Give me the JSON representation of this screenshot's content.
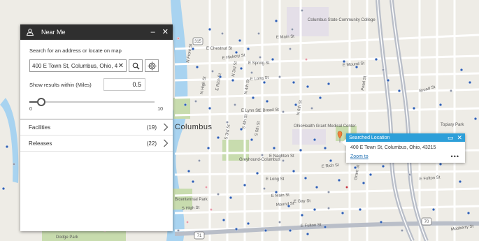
{
  "map": {
    "city_label": "Columbus",
    "street_labels": [
      "E Chestnut St",
      "E Hickory St",
      "E Spring St",
      "E Long St",
      "E Lynn St",
      "E Broad St",
      "E Rich St",
      "E Main St",
      "E Mound St",
      "E Fulton St",
      "Broad St",
      "E Naghten St",
      "E Long St",
      "E Main St",
      "Mound St",
      "Grant St",
      "E Rich St",
      "N 6th St",
      "N 4th St",
      "S 4th St",
      "S 5th St",
      "S 3rd St",
      "N Front St",
      "N High St",
      "S High St",
      "E Fulton St",
      "Mooberry St",
      "Pearl St",
      "N 3rd St",
      "E Gay St"
    ],
    "poi_labels": [
      "Columbus State Community College",
      "Greyhound-Columbus",
      "OhioHealth Grant Medical Center",
      "Dodge Park",
      "Bicentennial Park",
      "Topiary Park"
    ],
    "route_shields": [
      "315",
      "70",
      "71"
    ]
  },
  "panel": {
    "title": "Near Me",
    "minimize_symbol": "–",
    "close_symbol": "✕",
    "search_label": "Search for an address or locate on map",
    "search_value": "400 E Town St, Columbus, Ohio, 43215",
    "search_placeholder": "",
    "clear_symbol": "✕",
    "radius_label": "Show results within (Miles)",
    "radius_value": "0.5",
    "slider_min": "0",
    "slider_max": "10",
    "slider_fraction": 0.05,
    "results": [
      {
        "name": "Facilities",
        "count": "(19)"
      },
      {
        "name": "Releases",
        "count": "(22)"
      }
    ]
  },
  "popup": {
    "title": "Searched Location",
    "maximize_symbol": "▭",
    "close_symbol": "✕",
    "address": "400 E Town St, Columbus, Ohio, 43215",
    "zoom_label": "Zoom to",
    "more_symbol": "•••"
  },
  "colors": {
    "header_bg": "#2f2f2f",
    "popup_header": "#2d9fd9",
    "link": "#1f6fb2",
    "marker_blue": "#2f5fb4",
    "marker_gray": "#8c94a8",
    "marker_pink": "#e79aa6",
    "marker_red": "#c4343f",
    "pin": "#f0803c",
    "water": "#a8d3f0",
    "park": "#c8dcae"
  }
}
